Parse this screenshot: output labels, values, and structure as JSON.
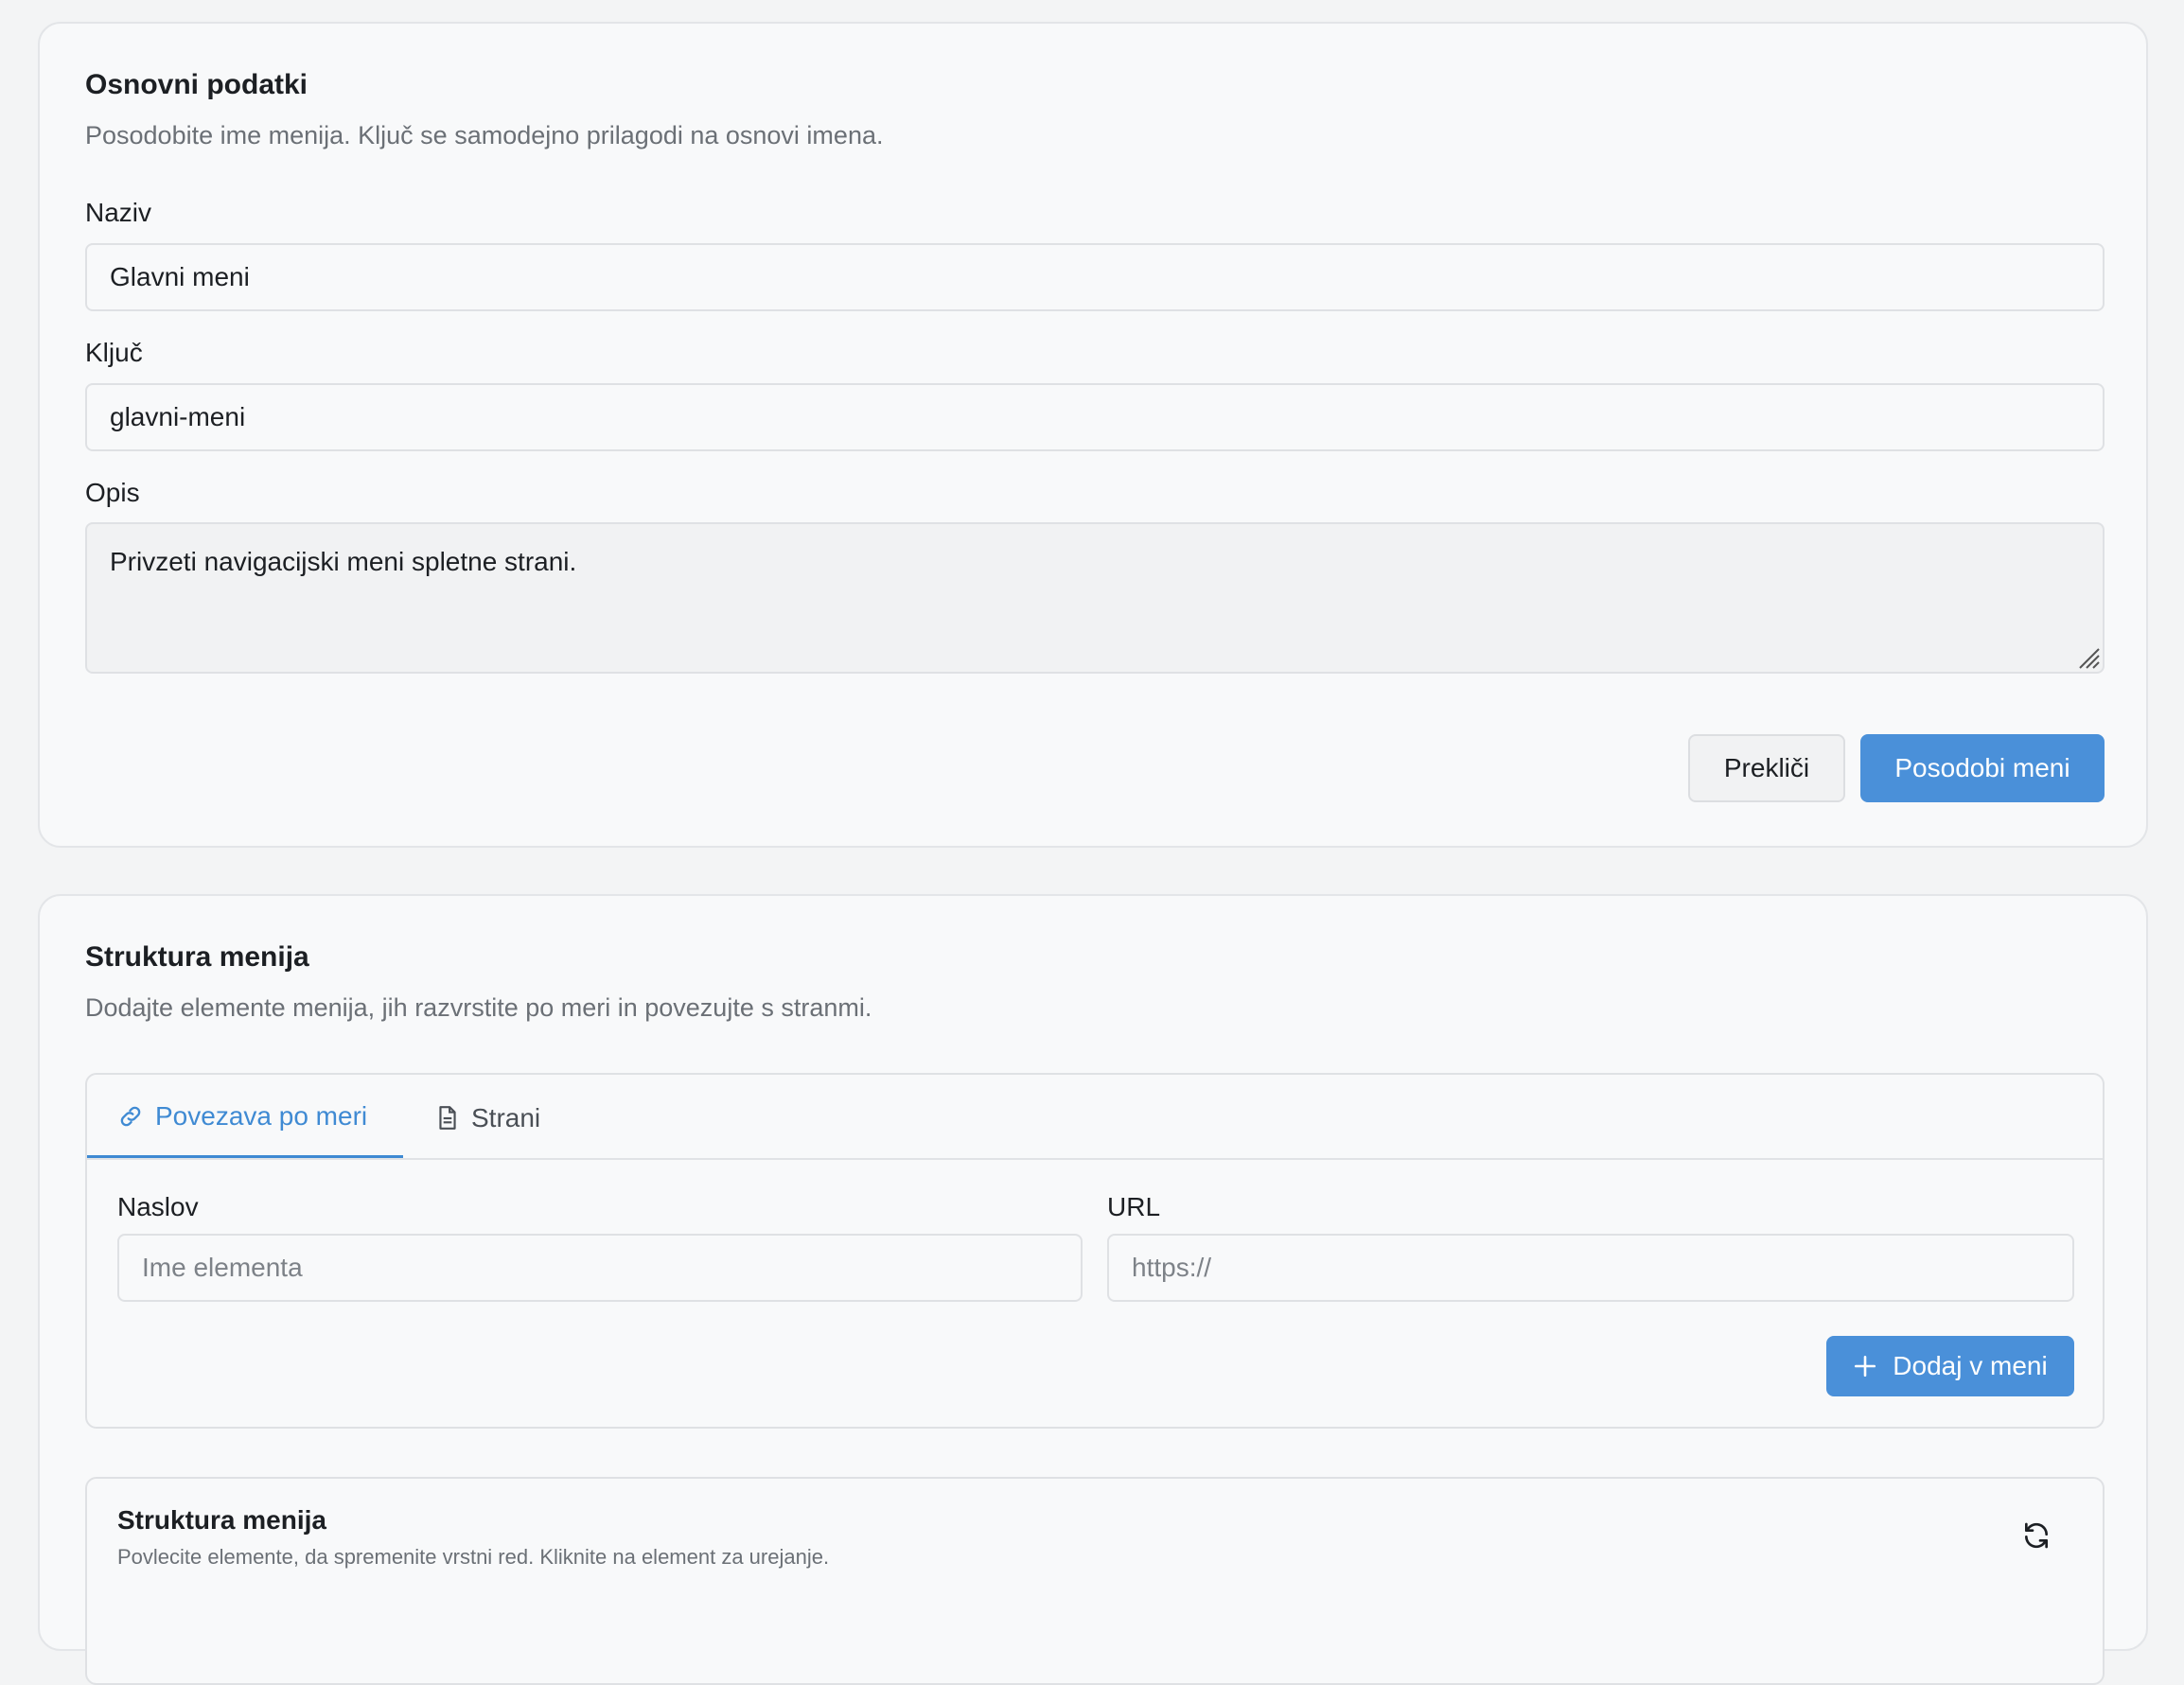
{
  "basic_section": {
    "title": "Osnovni podatki",
    "subtitle": "Posodobite ime menija. Ključ se samodejno prilagodi na osnovi imena.",
    "name_label": "Naziv",
    "name_value": "Glavni meni",
    "key_label": "Ključ",
    "key_value": "glavni-meni",
    "description_label": "Opis",
    "description_value": "Privzeti navigacijski meni spletne strani.",
    "cancel_label": "Prekliči",
    "submit_label": "Posodobi meni"
  },
  "structure_section": {
    "title": "Struktura menija",
    "subtitle": "Dodajte elemente menija, jih razvrstite po meri in povezujte s stranmi.",
    "tabs": [
      {
        "label": "Povezava po meri",
        "icon": "link-icon",
        "active": true
      },
      {
        "label": "Strani",
        "icon": "document-icon",
        "active": false
      }
    ],
    "custom_link": {
      "title_label": "Naslov",
      "title_placeholder": "Ime elementa",
      "url_label": "URL",
      "url_placeholder": "https://",
      "add_label": "Dodaj v meni"
    },
    "tree": {
      "title": "Struktura menija",
      "subtitle": "Povlecite elemente, da spremenite vrstni red. Kliknite na element za urejanje.",
      "refresh_icon": "refresh-icon"
    }
  },
  "colors": {
    "primary": "#4a90d9",
    "tab_active": "#3f8ad3",
    "background": "#f3f4f5",
    "card": "#f8f9fa"
  }
}
